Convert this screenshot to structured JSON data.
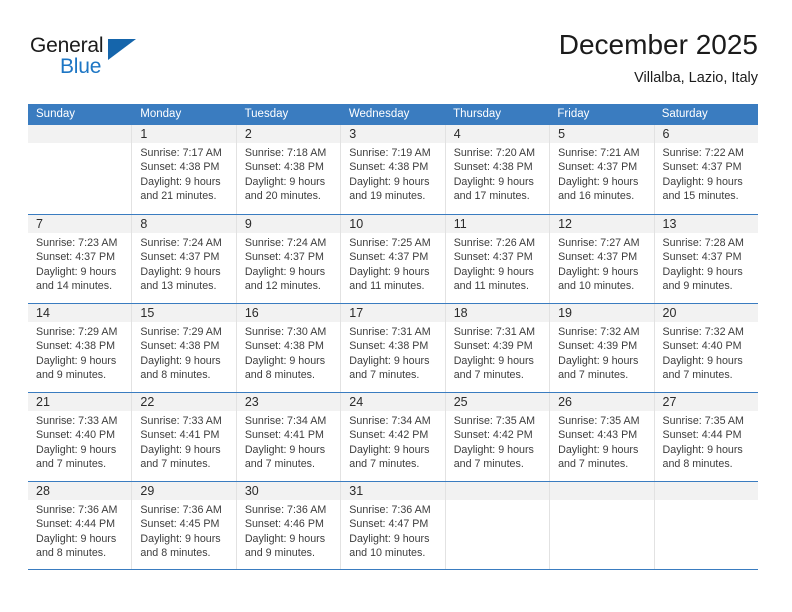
{
  "logo": {
    "word_top": "General",
    "word_bottom": "Blue",
    "triangle_color": "#1565ab",
    "blue_color": "#1d76c4"
  },
  "header": {
    "title": "December 2025",
    "subtitle": "Villalba, Lazio, Italy",
    "accent_color": "#3a7cc0"
  },
  "weekday_headers": [
    "Sunday",
    "Monday",
    "Tuesday",
    "Wednesday",
    "Thursday",
    "Friday",
    "Saturday"
  ],
  "weeks": [
    [
      {
        "day": "",
        "sunrise": "",
        "sunset": "",
        "daylight_1": "",
        "daylight_2": ""
      },
      {
        "day": "1",
        "sunrise": "Sunrise: 7:17 AM",
        "sunset": "Sunset: 4:38 PM",
        "daylight_1": "Daylight: 9 hours",
        "daylight_2": "and 21 minutes."
      },
      {
        "day": "2",
        "sunrise": "Sunrise: 7:18 AM",
        "sunset": "Sunset: 4:38 PM",
        "daylight_1": "Daylight: 9 hours",
        "daylight_2": "and 20 minutes."
      },
      {
        "day": "3",
        "sunrise": "Sunrise: 7:19 AM",
        "sunset": "Sunset: 4:38 PM",
        "daylight_1": "Daylight: 9 hours",
        "daylight_2": "and 19 minutes."
      },
      {
        "day": "4",
        "sunrise": "Sunrise: 7:20 AM",
        "sunset": "Sunset: 4:38 PM",
        "daylight_1": "Daylight: 9 hours",
        "daylight_2": "and 17 minutes."
      },
      {
        "day": "5",
        "sunrise": "Sunrise: 7:21 AM",
        "sunset": "Sunset: 4:37 PM",
        "daylight_1": "Daylight: 9 hours",
        "daylight_2": "and 16 minutes."
      },
      {
        "day": "6",
        "sunrise": "Sunrise: 7:22 AM",
        "sunset": "Sunset: 4:37 PM",
        "daylight_1": "Daylight: 9 hours",
        "daylight_2": "and 15 minutes."
      }
    ],
    [
      {
        "day": "7",
        "sunrise": "Sunrise: 7:23 AM",
        "sunset": "Sunset: 4:37 PM",
        "daylight_1": "Daylight: 9 hours",
        "daylight_2": "and 14 minutes."
      },
      {
        "day": "8",
        "sunrise": "Sunrise: 7:24 AM",
        "sunset": "Sunset: 4:37 PM",
        "daylight_1": "Daylight: 9 hours",
        "daylight_2": "and 13 minutes."
      },
      {
        "day": "9",
        "sunrise": "Sunrise: 7:24 AM",
        "sunset": "Sunset: 4:37 PM",
        "daylight_1": "Daylight: 9 hours",
        "daylight_2": "and 12 minutes."
      },
      {
        "day": "10",
        "sunrise": "Sunrise: 7:25 AM",
        "sunset": "Sunset: 4:37 PM",
        "daylight_1": "Daylight: 9 hours",
        "daylight_2": "and 11 minutes."
      },
      {
        "day": "11",
        "sunrise": "Sunrise: 7:26 AM",
        "sunset": "Sunset: 4:37 PM",
        "daylight_1": "Daylight: 9 hours",
        "daylight_2": "and 11 minutes."
      },
      {
        "day": "12",
        "sunrise": "Sunrise: 7:27 AM",
        "sunset": "Sunset: 4:37 PM",
        "daylight_1": "Daylight: 9 hours",
        "daylight_2": "and 10 minutes."
      },
      {
        "day": "13",
        "sunrise": "Sunrise: 7:28 AM",
        "sunset": "Sunset: 4:37 PM",
        "daylight_1": "Daylight: 9 hours",
        "daylight_2": "and 9 minutes."
      }
    ],
    [
      {
        "day": "14",
        "sunrise": "Sunrise: 7:29 AM",
        "sunset": "Sunset: 4:38 PM",
        "daylight_1": "Daylight: 9 hours",
        "daylight_2": "and 9 minutes."
      },
      {
        "day": "15",
        "sunrise": "Sunrise: 7:29 AM",
        "sunset": "Sunset: 4:38 PM",
        "daylight_1": "Daylight: 9 hours",
        "daylight_2": "and 8 minutes."
      },
      {
        "day": "16",
        "sunrise": "Sunrise: 7:30 AM",
        "sunset": "Sunset: 4:38 PM",
        "daylight_1": "Daylight: 9 hours",
        "daylight_2": "and 8 minutes."
      },
      {
        "day": "17",
        "sunrise": "Sunrise: 7:31 AM",
        "sunset": "Sunset: 4:38 PM",
        "daylight_1": "Daylight: 9 hours",
        "daylight_2": "and 7 minutes."
      },
      {
        "day": "18",
        "sunrise": "Sunrise: 7:31 AM",
        "sunset": "Sunset: 4:39 PM",
        "daylight_1": "Daylight: 9 hours",
        "daylight_2": "and 7 minutes."
      },
      {
        "day": "19",
        "sunrise": "Sunrise: 7:32 AM",
        "sunset": "Sunset: 4:39 PM",
        "daylight_1": "Daylight: 9 hours",
        "daylight_2": "and 7 minutes."
      },
      {
        "day": "20",
        "sunrise": "Sunrise: 7:32 AM",
        "sunset": "Sunset: 4:40 PM",
        "daylight_1": "Daylight: 9 hours",
        "daylight_2": "and 7 minutes."
      }
    ],
    [
      {
        "day": "21",
        "sunrise": "Sunrise: 7:33 AM",
        "sunset": "Sunset: 4:40 PM",
        "daylight_1": "Daylight: 9 hours",
        "daylight_2": "and 7 minutes."
      },
      {
        "day": "22",
        "sunrise": "Sunrise: 7:33 AM",
        "sunset": "Sunset: 4:41 PM",
        "daylight_1": "Daylight: 9 hours",
        "daylight_2": "and 7 minutes."
      },
      {
        "day": "23",
        "sunrise": "Sunrise: 7:34 AM",
        "sunset": "Sunset: 4:41 PM",
        "daylight_1": "Daylight: 9 hours",
        "daylight_2": "and 7 minutes."
      },
      {
        "day": "24",
        "sunrise": "Sunrise: 7:34 AM",
        "sunset": "Sunset: 4:42 PM",
        "daylight_1": "Daylight: 9 hours",
        "daylight_2": "and 7 minutes."
      },
      {
        "day": "25",
        "sunrise": "Sunrise: 7:35 AM",
        "sunset": "Sunset: 4:42 PM",
        "daylight_1": "Daylight: 9 hours",
        "daylight_2": "and 7 minutes."
      },
      {
        "day": "26",
        "sunrise": "Sunrise: 7:35 AM",
        "sunset": "Sunset: 4:43 PM",
        "daylight_1": "Daylight: 9 hours",
        "daylight_2": "and 7 minutes."
      },
      {
        "day": "27",
        "sunrise": "Sunrise: 7:35 AM",
        "sunset": "Sunset: 4:44 PM",
        "daylight_1": "Daylight: 9 hours",
        "daylight_2": "and 8 minutes."
      }
    ],
    [
      {
        "day": "28",
        "sunrise": "Sunrise: 7:36 AM",
        "sunset": "Sunset: 4:44 PM",
        "daylight_1": "Daylight: 9 hours",
        "daylight_2": "and 8 minutes."
      },
      {
        "day": "29",
        "sunrise": "Sunrise: 7:36 AM",
        "sunset": "Sunset: 4:45 PM",
        "daylight_1": "Daylight: 9 hours",
        "daylight_2": "and 8 minutes."
      },
      {
        "day": "30",
        "sunrise": "Sunrise: 7:36 AM",
        "sunset": "Sunset: 4:46 PM",
        "daylight_1": "Daylight: 9 hours",
        "daylight_2": "and 9 minutes."
      },
      {
        "day": "31",
        "sunrise": "Sunrise: 7:36 AM",
        "sunset": "Sunset: 4:47 PM",
        "daylight_1": "Daylight: 9 hours",
        "daylight_2": "and 10 minutes."
      },
      {
        "day": "",
        "sunrise": "",
        "sunset": "",
        "daylight_1": "",
        "daylight_2": ""
      },
      {
        "day": "",
        "sunrise": "",
        "sunset": "",
        "daylight_1": "",
        "daylight_2": ""
      },
      {
        "day": "",
        "sunrise": "",
        "sunset": "",
        "daylight_1": "",
        "daylight_2": ""
      }
    ]
  ]
}
